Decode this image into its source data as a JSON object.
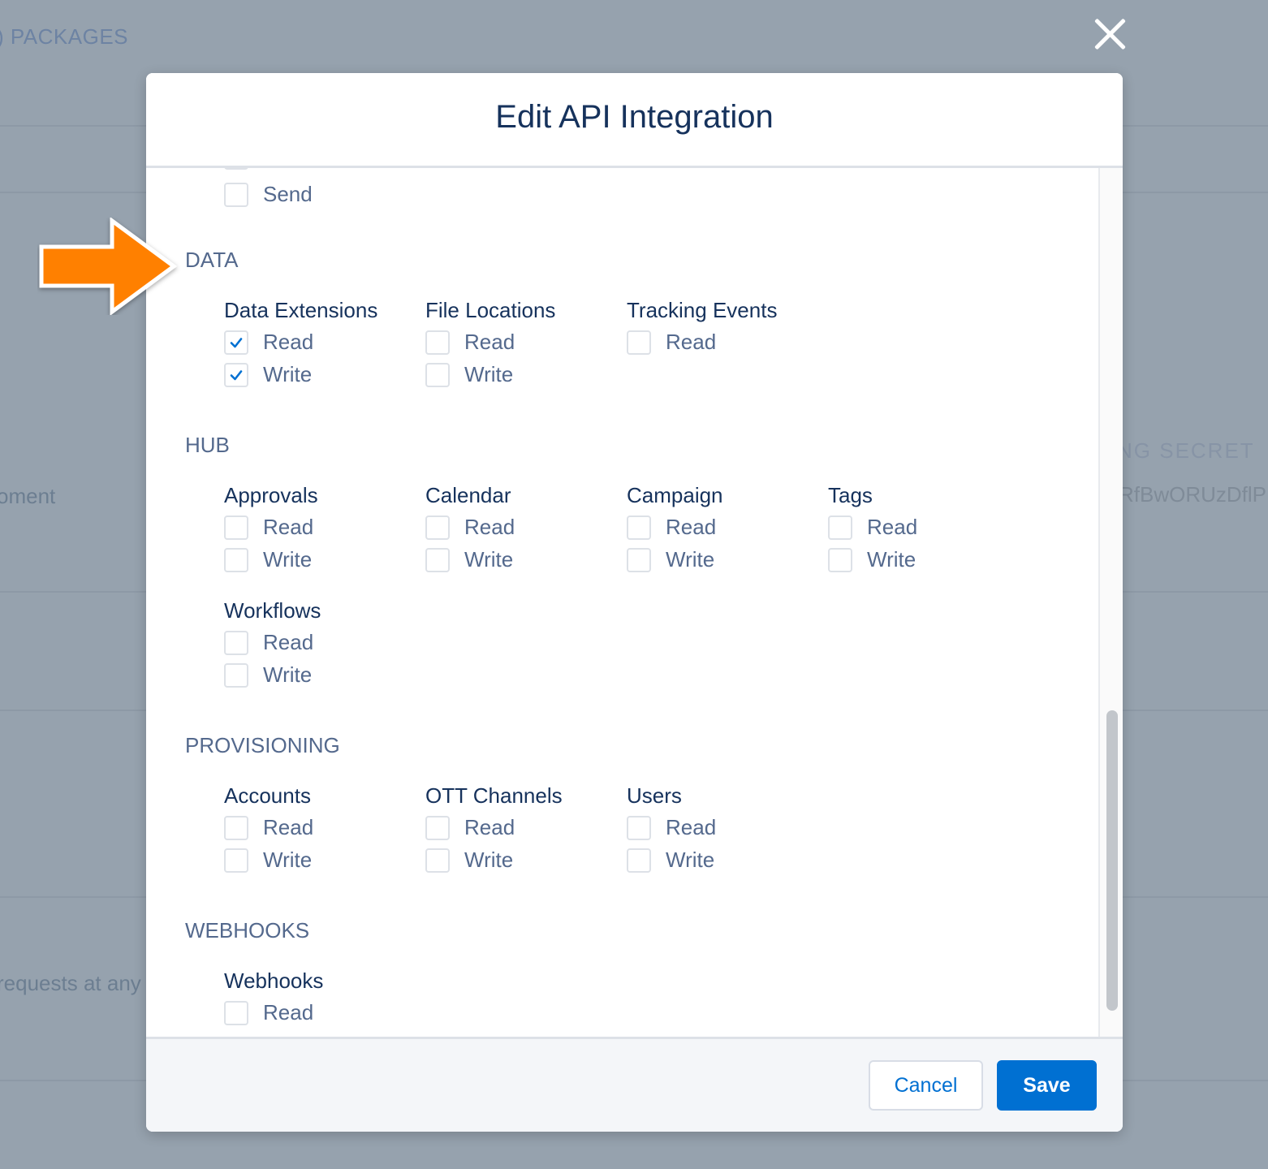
{
  "background": {
    "packages_heading": ") PACKAGES",
    "signing_secret_heading": "NG SECRET",
    "secret_value": "RfBwORUzDflP",
    "left_fragment_1": "oment",
    "left_fragment_2": "requests at any"
  },
  "modal": {
    "title": "Edit API Integration",
    "partial_item_label": "Send",
    "sections": {
      "data": {
        "title": "DATA",
        "groups": [
          {
            "title": "Data Extensions",
            "options": [
              {
                "label": "Read",
                "checked": true
              },
              {
                "label": "Write",
                "checked": true
              }
            ]
          },
          {
            "title": "File Locations",
            "options": [
              {
                "label": "Read",
                "checked": false
              },
              {
                "label": "Write",
                "checked": false
              }
            ]
          },
          {
            "title": "Tracking Events",
            "options": [
              {
                "label": "Read",
                "checked": false
              }
            ]
          }
        ]
      },
      "hub": {
        "title": "HUB",
        "groups": [
          {
            "title": "Approvals",
            "options": [
              {
                "label": "Read",
                "checked": false
              },
              {
                "label": "Write",
                "checked": false
              }
            ]
          },
          {
            "title": "Calendar",
            "options": [
              {
                "label": "Read",
                "checked": false
              },
              {
                "label": "Write",
                "checked": false
              }
            ]
          },
          {
            "title": "Campaign",
            "options": [
              {
                "label": "Read",
                "checked": false
              },
              {
                "label": "Write",
                "checked": false
              }
            ]
          },
          {
            "title": "Tags",
            "options": [
              {
                "label": "Read",
                "checked": false
              },
              {
                "label": "Write",
                "checked": false
              }
            ]
          },
          {
            "title": "Workflows",
            "options": [
              {
                "label": "Read",
                "checked": false
              },
              {
                "label": "Write",
                "checked": false
              }
            ]
          }
        ]
      },
      "provisioning": {
        "title": "PROVISIONING",
        "groups": [
          {
            "title": "Accounts",
            "options": [
              {
                "label": "Read",
                "checked": false
              },
              {
                "label": "Write",
                "checked": false
              }
            ]
          },
          {
            "title": "OTT Channels",
            "options": [
              {
                "label": "Read",
                "checked": false
              },
              {
                "label": "Write",
                "checked": false
              }
            ]
          },
          {
            "title": "Users",
            "options": [
              {
                "label": "Read",
                "checked": false
              },
              {
                "label": "Write",
                "checked": false
              }
            ]
          }
        ]
      },
      "webhooks": {
        "title": "WEBHOOKS",
        "groups": [
          {
            "title": "Webhooks",
            "options": [
              {
                "label": "Read",
                "checked": false
              }
            ]
          }
        ]
      }
    },
    "footer": {
      "cancel_label": "Cancel",
      "save_label": "Save"
    }
  },
  "colors": {
    "accent": "#0070d2",
    "arrow": "#ff8000",
    "title": "#16325c",
    "muted": "#54698d"
  }
}
